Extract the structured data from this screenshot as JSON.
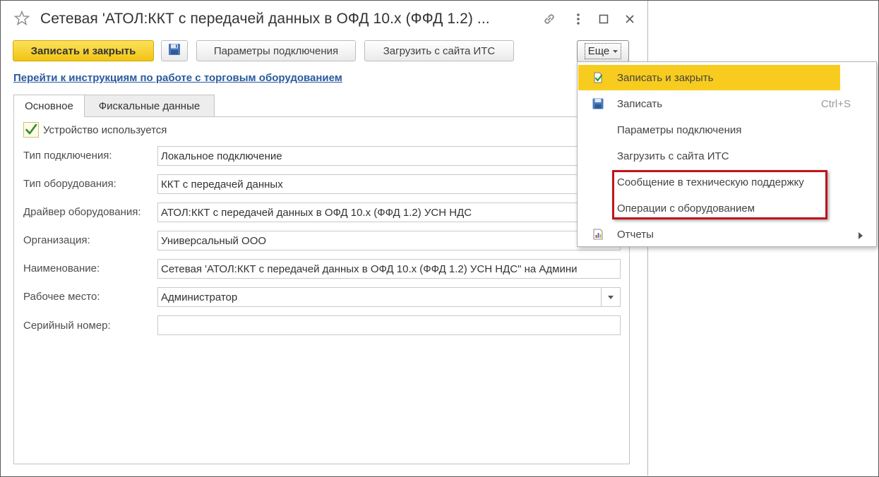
{
  "window": {
    "title": "Сетевая 'АТОЛ:ККТ с передачей данных в ОФД 10.х (ФФД 1.2) ...",
    "icons": [
      "star-icon",
      "link-icon",
      "more-vertical-icon",
      "maximize-icon",
      "close-icon"
    ]
  },
  "toolbar": {
    "save_close_label": "Записать и закрыть",
    "save_icon": "floppy-disk-icon",
    "connection_params_label": "Параметры подключения",
    "load_its_label": "Загрузить с сайта ИТС",
    "more_label": "Еще"
  },
  "instructions_link": "Перейти к инструкциям по работе с торговым оборудованием",
  "tabs": [
    {
      "label": "Основное",
      "active": true
    },
    {
      "label": "Фискальные данные",
      "active": false
    }
  ],
  "form": {
    "device_used_label": "Устройство используется",
    "device_used_checked": true,
    "fields": [
      {
        "label": "Тип подключения:",
        "value": "Локальное подключение"
      },
      {
        "label": "Тип оборудования:",
        "value": "ККТ с передачей данных"
      },
      {
        "label": "Драйвер оборудования:",
        "value": "АТОЛ:ККТ с передачей данных в ОФД 10.х (ФФД 1.2) УСН НДС"
      },
      {
        "label": "Организация:",
        "value": "Универсальный ООО"
      },
      {
        "label": "Наименование:",
        "value": "Сетевая 'АТОЛ:ККТ с передачей данных в ОФД 10.х (ФФД 1.2) УСН НДС\" на Админи"
      },
      {
        "label": "Рабочее место:",
        "value": "Администратор"
      },
      {
        "label": "Серийный номер:",
        "value": ""
      }
    ]
  },
  "more_menu": {
    "items": [
      {
        "label": "Записать и закрыть",
        "icon": "save-and-close-icon",
        "highlighted": true
      },
      {
        "label": "Записать",
        "icon": "floppy-disk-icon",
        "shortcut": "Ctrl+S"
      },
      {
        "label": "Параметры подключения"
      },
      {
        "label": "Загрузить с сайта ИТС"
      },
      {
        "label": "Сообщение в техническую поддержку",
        "outlined": true
      },
      {
        "label": "Операции с оборудованием",
        "outlined": true
      },
      {
        "label": "Отчеты",
        "icon": "report-icon",
        "submenu": true
      }
    ]
  },
  "colors": {
    "primary_button": "#f5cb1f",
    "menu_highlight": "#f8cc1e",
    "link": "#2a5a9e",
    "annotation_outline": "#c0141c",
    "checkmark": "#2e8b2e"
  }
}
